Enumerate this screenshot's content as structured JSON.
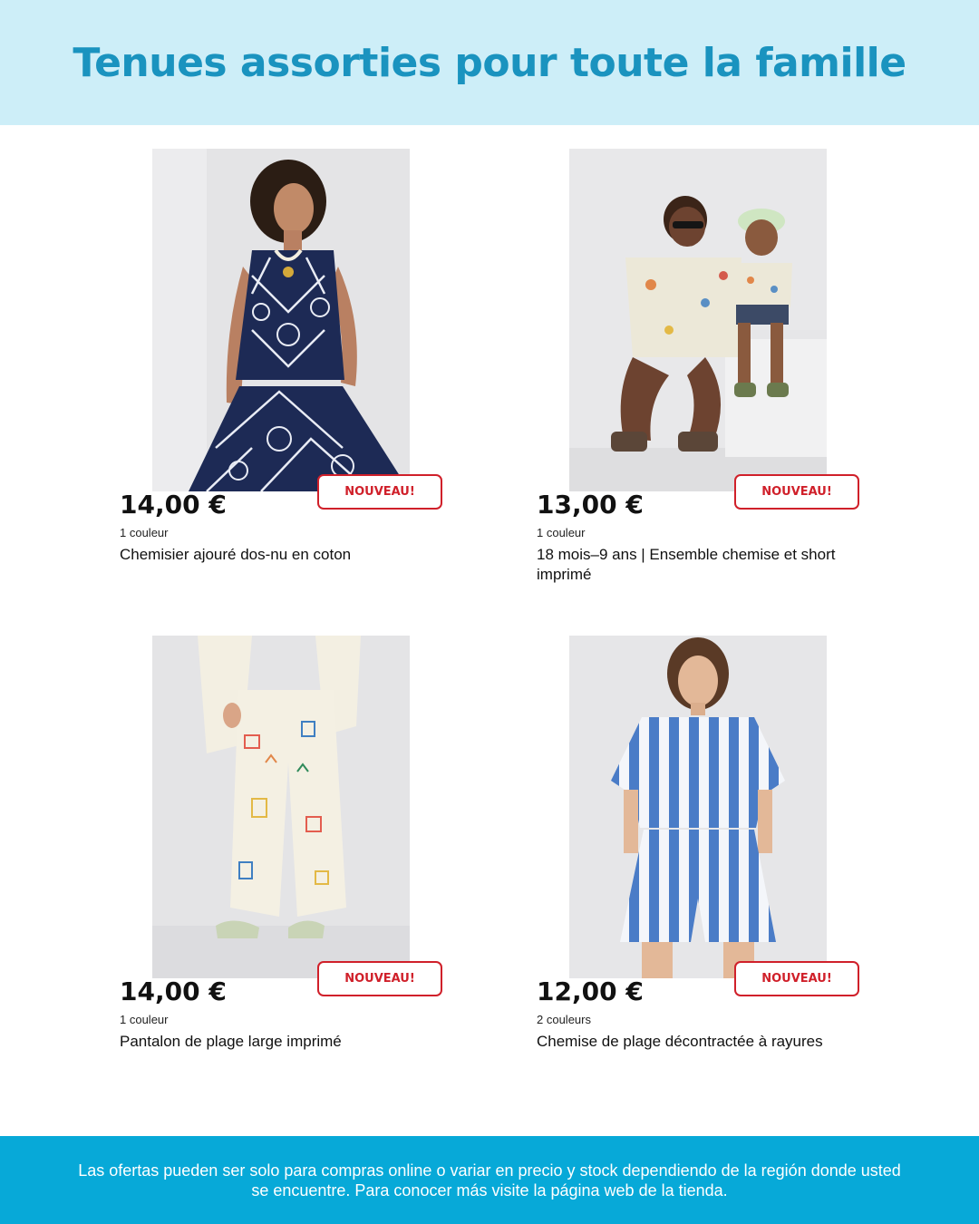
{
  "header": {
    "title": "Tenues assorties pour toute la famille"
  },
  "products": [
    {
      "price": "14,00 €",
      "badge": "NOUVEAU!",
      "colors": "1 couleur",
      "name": "Chemisier ajouré dos-nu en coton"
    },
    {
      "price": "13,00 €",
      "badge": "NOUVEAU!",
      "colors": "1 couleur",
      "name": "18 mois–9 ans | Ensemble chemise et short imprimé"
    },
    {
      "price": "14,00 €",
      "badge": "NOUVEAU!",
      "colors": "1 couleur",
      "name": "Pantalon de plage large imprimé"
    },
    {
      "price": "12,00 €",
      "badge": "NOUVEAU!",
      "colors": "2 couleurs",
      "name": "Chemise de plage décontractée à rayures"
    }
  ],
  "footer": {
    "disclaimer": "Las ofertas pueden ser solo para compras online o variar en precio y stock dependiendo de la región donde usted se encuentre. Para conocer más visite la página web de la tienda."
  },
  "colors": {
    "header_bg": "#cdeef8",
    "title": "#1a93bf",
    "badge": "#d0202a",
    "footer_bg": "#07a9d8"
  }
}
